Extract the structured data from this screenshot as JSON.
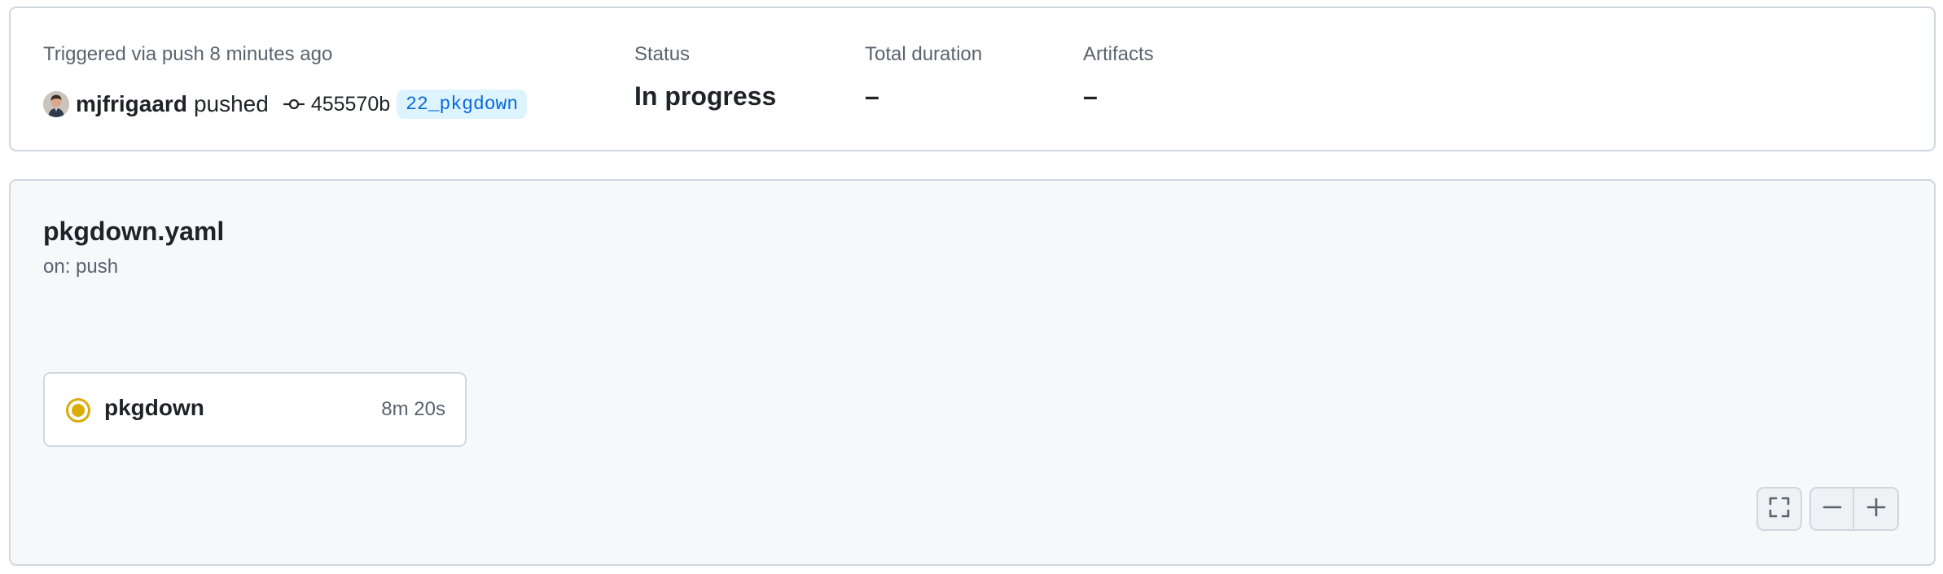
{
  "run_summary": {
    "trigger_label": "Triggered via push 8 minutes ago",
    "actor": "mjfrigaard",
    "action": "pushed",
    "commit_sha": "455570b",
    "branch": "22_pkgdown",
    "status_label": "Status",
    "status_value": "In progress",
    "duration_label": "Total duration",
    "duration_value": "–",
    "artifacts_label": "Artifacts",
    "artifacts_value": "–"
  },
  "workflow": {
    "name": "pkgdown.yaml",
    "trigger": "on: push",
    "jobs": [
      {
        "name": "pkgdown",
        "duration": "8m 20s",
        "status": "in_progress",
        "status_icon": "in-progress-icon"
      }
    ]
  },
  "graph_controls": {
    "fullscreen_icon": "fullscreen-icon",
    "zoom_out_icon": "minus-icon",
    "zoom_in_icon": "plus-icon"
  },
  "colors": {
    "in_progress": "#dbab0a",
    "branch_bg": "#ddf4ff",
    "branch_text": "#0969da",
    "graph_bg": "#f6f8fa",
    "border": "#d0d7de"
  }
}
